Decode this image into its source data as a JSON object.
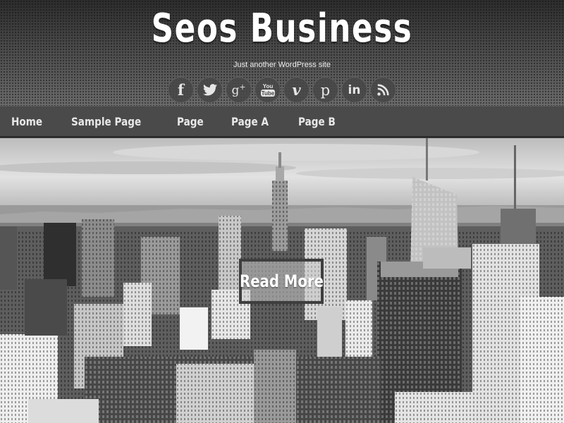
{
  "site": {
    "title": "Seos Business",
    "tagline": "Just another WordPress site"
  },
  "social": [
    {
      "icon": "facebook-icon",
      "glyph": "f"
    },
    {
      "icon": "twitter-icon",
      "glyph": "bird"
    },
    {
      "icon": "google-plus-icon",
      "glyph": "g+"
    },
    {
      "icon": "youtube-icon",
      "glyph": "You Tube"
    },
    {
      "icon": "vimeo-icon",
      "glyph": "v"
    },
    {
      "icon": "pinterest-icon",
      "glyph": "p"
    },
    {
      "icon": "linkedin-icon",
      "glyph": "in"
    },
    {
      "icon": "rss-icon",
      "glyph": "rss"
    }
  ],
  "nav": {
    "items": [
      "Home",
      "Sample Page",
      "Page",
      "Page A",
      "Page B"
    ]
  },
  "hero": {
    "button_label": "Read More",
    "image": "city-skyline-image"
  },
  "colors": {
    "header_bg": "#4a4a4a",
    "nav_bg": "#4a4a4a",
    "title": "#ffffff",
    "social_bg": "#464646",
    "button_border": "#3e3e3e"
  }
}
